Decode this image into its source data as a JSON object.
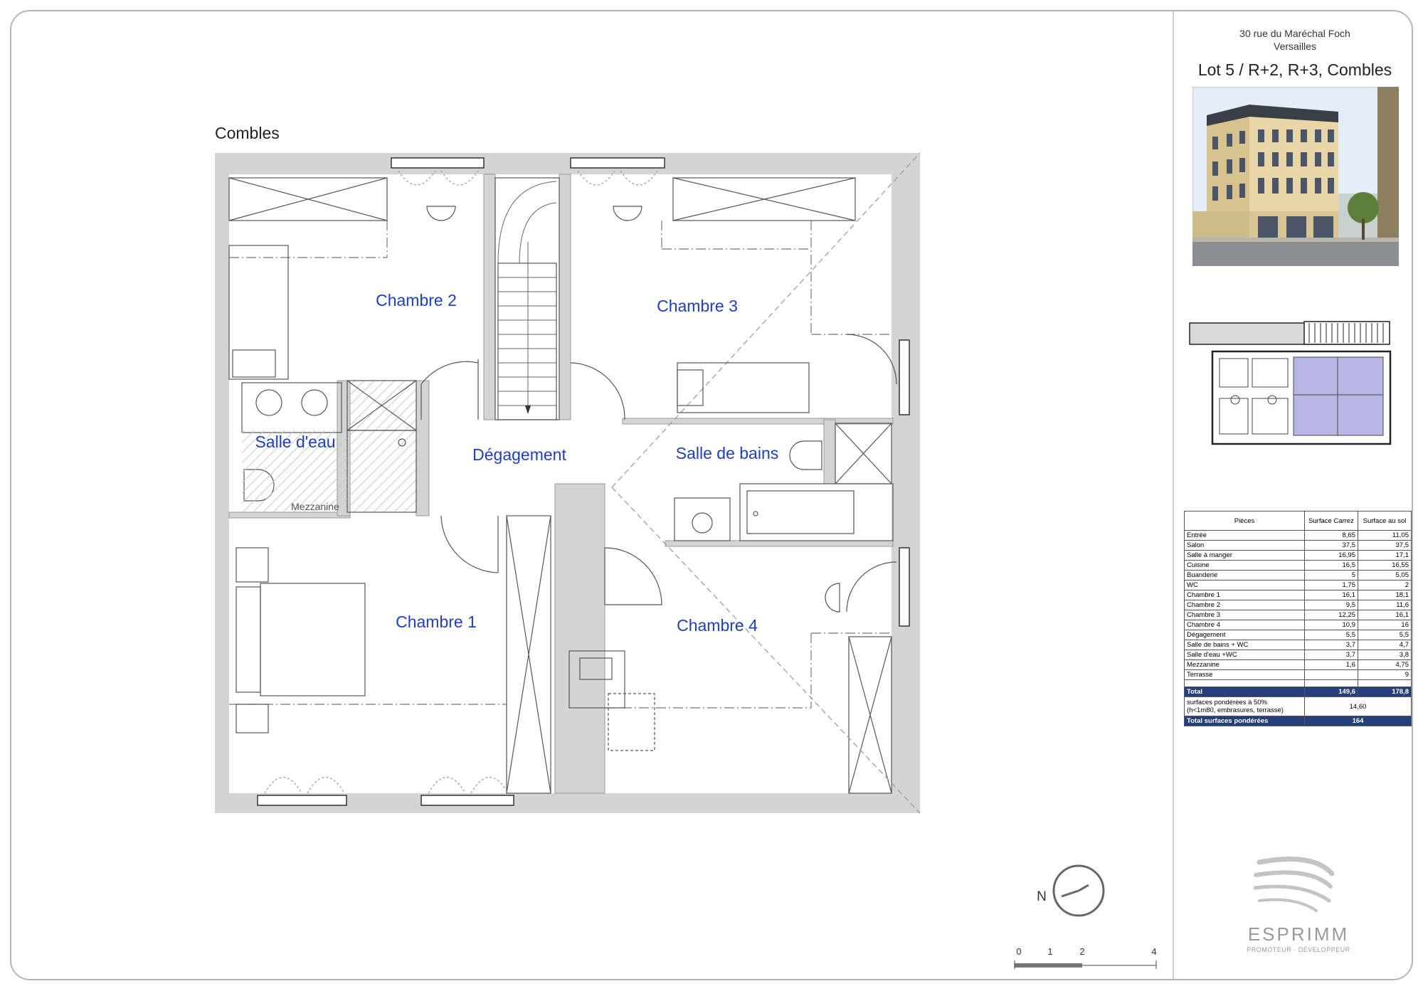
{
  "header": {
    "address_line1": "30 rue du Maréchal Foch",
    "address_line2": "Versailles",
    "lot_title": "Lot 5 / R+2, R+3, Combles"
  },
  "plan": {
    "level_label": "Combles",
    "rooms": {
      "chambre2": "Chambre 2",
      "chambre3": "Chambre 3",
      "salle_eau": "Salle d'eau",
      "degagement": "Dégagement",
      "salle_bains": "Salle de bains",
      "mezzanine": "Mezzanine",
      "chambre1": "Chambre 1",
      "chambre4": "Chambre 4"
    },
    "north_label": "N",
    "scale_ticks": [
      "0",
      "1",
      "2",
      "4"
    ]
  },
  "table": {
    "headers": [
      "Pièces",
      "Surface Carrez",
      "Surface au sol"
    ],
    "rows": [
      [
        "Entrée",
        "8,65",
        "11,05"
      ],
      [
        "Salon",
        "37,5",
        "37,5"
      ],
      [
        "Salle à manger",
        "16,95",
        "17,1"
      ],
      [
        "Cuisine",
        "16,5",
        "16,55"
      ],
      [
        "Buanderie",
        "5",
        "5,05"
      ],
      [
        "WC",
        "1,75",
        "2"
      ],
      [
        "Chambre 1",
        "16,1",
        "18,1"
      ],
      [
        "Chambre 2",
        "9,5",
        "11,6"
      ],
      [
        "Chambre 3",
        "12,25",
        "16,1"
      ],
      [
        "Chambre 4",
        "10,9",
        "16"
      ],
      [
        "Dégagement",
        "5,5",
        "5,5"
      ],
      [
        "Salle de bains + WC",
        "3,7",
        "4,7"
      ],
      [
        "Salle d'eau +WC",
        "3,7",
        "3,8"
      ],
      [
        "Mezzanine",
        "1,6",
        "4,75"
      ],
      [
        "Terrasse",
        "",
        "9"
      ]
    ],
    "total": [
      "Total",
      "149,6",
      "178,8"
    ],
    "ponderees_line1": "surfaces pondérées à 50%",
    "ponderees_line2": "(h<1m80, embrasures, terrasse)",
    "ponderees_value": "14,60",
    "total_ponderees": [
      "Total surfaces pondérées",
      "164"
    ]
  },
  "logo": {
    "name": "ESPRIMM",
    "tagline": "PROMOTEUR · DÉVELOPPEUR"
  },
  "colors": {
    "wall_grey": "#d4d4d4",
    "room_text_blue": "#1f3fbf",
    "table_header_blue": "#243f7a",
    "keyplan_highlight": "#b7b7e6"
  }
}
